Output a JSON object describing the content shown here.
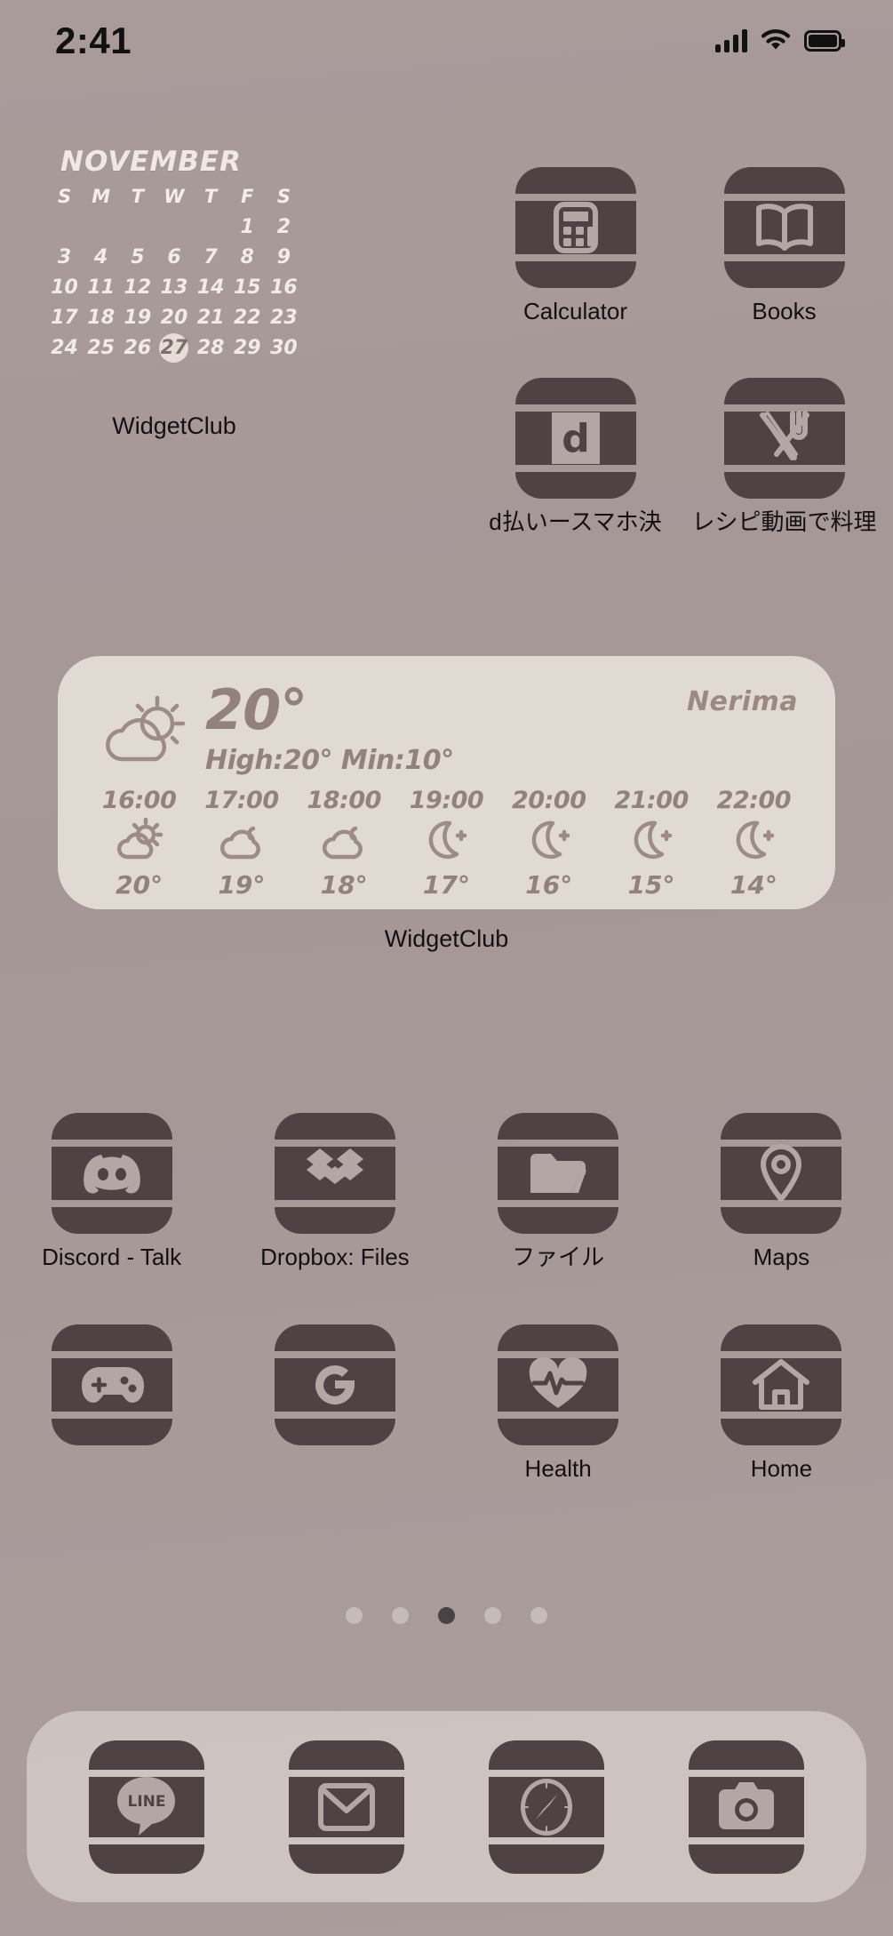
{
  "statusbar": {
    "time": "2:41",
    "cellular_icon": "signal-bars-icon",
    "wifi_icon": "wifi-icon",
    "battery_icon": "battery-full-icon"
  },
  "calendar_widget": {
    "month": "NOVEMBER",
    "weekday_headers": [
      "S",
      "M",
      "T",
      "W",
      "T",
      "F",
      "S"
    ],
    "leading_blanks": 5,
    "days": [
      1,
      2,
      3,
      4,
      5,
      6,
      7,
      8,
      9,
      10,
      11,
      12,
      13,
      14,
      15,
      16,
      17,
      18,
      19,
      20,
      21,
      22,
      23,
      24,
      25,
      26,
      27,
      28,
      29,
      30
    ],
    "today": 27,
    "label": "WidgetClub"
  },
  "top_apps": [
    {
      "label": "Calculator",
      "icon": "calculator-icon"
    },
    {
      "label": "Books",
      "icon": "books-icon"
    },
    {
      "label": "d払いースマホ決",
      "icon": "dpay-icon"
    },
    {
      "label": "レシピ動画で料理",
      "icon": "recipe-icon"
    }
  ],
  "weather_widget": {
    "city": "Nerima",
    "current_temp": "20°",
    "high_low": "High:20° Min:10°",
    "condition_icon": "sun-cloud-icon",
    "label": "WidgetClub",
    "hourly": [
      {
        "time": "16:00",
        "icon": "sun-cloud-icon",
        "temp": "20°"
      },
      {
        "time": "17:00",
        "icon": "cloud-icon",
        "temp": "19°"
      },
      {
        "time": "18:00",
        "icon": "cloud-icon",
        "temp": "18°"
      },
      {
        "time": "19:00",
        "icon": "moon-star-icon",
        "temp": "17°"
      },
      {
        "time": "20:00",
        "icon": "moon-star-icon",
        "temp": "16°"
      },
      {
        "time": "21:00",
        "icon": "moon-star-icon",
        "temp": "15°"
      },
      {
        "time": "22:00",
        "icon": "moon-star-icon",
        "temp": "14°"
      }
    ]
  },
  "app_row_3": [
    {
      "label": "Discord - Talk",
      "icon": "discord-icon"
    },
    {
      "label": "Dropbox: Files",
      "icon": "dropbox-icon"
    },
    {
      "label": "ファイル",
      "icon": "files-icon"
    },
    {
      "label": "Maps",
      "icon": "maps-pin-icon"
    }
  ],
  "app_row_4": [
    {
      "label": "",
      "icon": "game-controller-icon"
    },
    {
      "label": "",
      "icon": "google-g-icon"
    },
    {
      "label": "Health",
      "icon": "heart-pulse-icon"
    },
    {
      "label": "Home",
      "icon": "house-icon"
    }
  ],
  "page_dots": {
    "count": 5,
    "active_index": 2
  },
  "dock": [
    {
      "label": "LINE",
      "icon": "line-icon"
    },
    {
      "label": "Mail",
      "icon": "mail-envelope-icon"
    },
    {
      "label": "Safari",
      "icon": "safari-compass-icon"
    },
    {
      "label": "Camera",
      "icon": "camera-icon"
    }
  ],
  "colors": {
    "wallpaper": "#a99b9a",
    "icon_body": "#4f4244",
    "icon_glyph": "#b3a6a4",
    "widget_card": "#e0dad3",
    "widget_text": "#92817c",
    "calendar_text": "#f2ece6",
    "label_text": "#140f12"
  }
}
